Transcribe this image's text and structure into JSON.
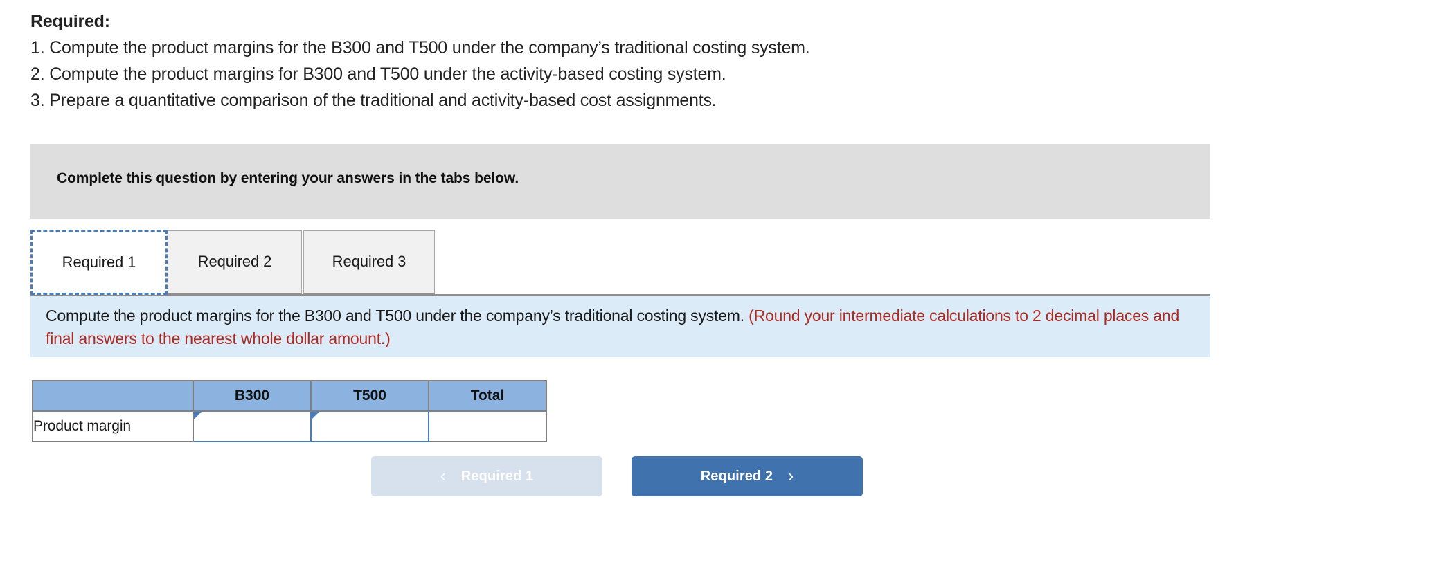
{
  "prompt": {
    "heading": "Required:",
    "lines": [
      "1. Compute the product margins for the B300 and T500 under the company’s traditional costing system.",
      "2. Compute the product margins for B300 and T500 under the activity-based costing system.",
      "3. Prepare a quantitative comparison of the traditional and activity-based cost assignments."
    ]
  },
  "gray_banner": {
    "text": "Complete this question by entering your answers in the tabs below."
  },
  "tabs": {
    "items": [
      {
        "label": "Required 1",
        "active": true
      },
      {
        "label": "Required 2",
        "active": false
      },
      {
        "label": "Required 3",
        "active": false
      }
    ]
  },
  "instruction_panel": {
    "main_text": "Compute the product margins for the B300 and T500 under the company’s traditional costing system. ",
    "red_text": "(Round your intermediate calculations to 2 decimal places and final answers to the nearest whole dollar amount.)",
    "background_color": "#dcebf8",
    "red_color": "#ab2b22"
  },
  "answer_table": {
    "headers": [
      "",
      "B300",
      "T500",
      "Total"
    ],
    "rows": [
      {
        "label": "Product margin",
        "b300": "",
        "t500": "",
        "total": ""
      }
    ],
    "header_color": "#8cb3e0",
    "input_border_color": "#4a7ebb"
  },
  "nav": {
    "prev_label": "Required 1",
    "prev_icon": "chevron-left-icon",
    "prev_glyph": "‹",
    "prev_disabled": true,
    "prev_color": "#d7e0ed",
    "next_label": "Required 2",
    "next_icon": "chevron-right-icon",
    "next_glyph": "›",
    "next_color": "#4072ad"
  }
}
